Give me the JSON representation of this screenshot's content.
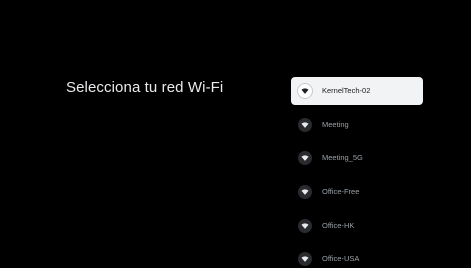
{
  "setup": {
    "title": "Selecciona tu red Wi-Fi"
  },
  "networks": [
    {
      "ssid": "KernelTech-02",
      "focused": true,
      "icon": "wifi-icon"
    },
    {
      "ssid": "Meeting",
      "focused": false,
      "icon": "wifi-icon"
    },
    {
      "ssid": "Meeting_5G",
      "focused": false,
      "icon": "wifi-icon"
    },
    {
      "ssid": "Office-Free",
      "focused": false,
      "icon": "wifi-icon"
    },
    {
      "ssid": "Office-HK",
      "focused": false,
      "icon": "wifi-icon"
    },
    {
      "ssid": "Office-USA",
      "focused": false,
      "icon": "wifi-icon"
    }
  ],
  "colors": {
    "background": "#000000",
    "title_text": "#e8eaed",
    "focused_bg": "#f1f3f4",
    "focused_text": "#202124",
    "item_text": "#9aa0a6"
  }
}
